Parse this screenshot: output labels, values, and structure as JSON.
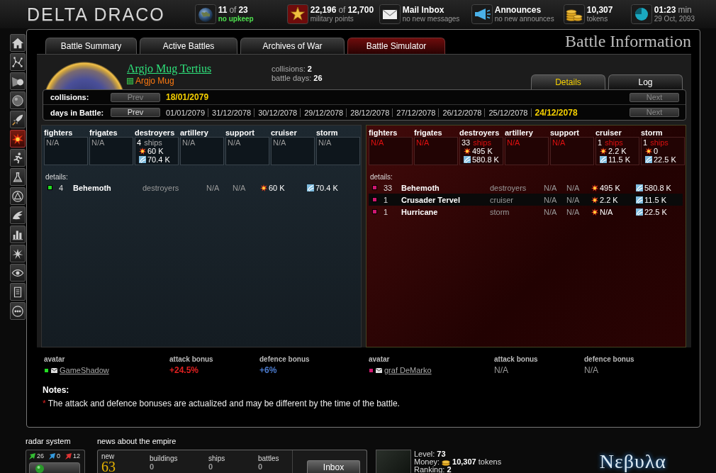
{
  "header": {
    "logo": "DELTA DRACO",
    "stats": [
      {
        "kind": "planets",
        "main": "11",
        "connector": "of",
        "total": "23",
        "caption": "no upkeep",
        "caption_highlighted": true
      },
      {
        "kind": "military",
        "main": "22,196",
        "connector": "of",
        "total": "12,700",
        "caption": "military points",
        "caption_highlighted": false
      },
      {
        "kind": "mail",
        "main": "Mail Inbox",
        "caption": "no new messages",
        "caption_highlighted": false
      },
      {
        "kind": "announces",
        "main": "Announces",
        "caption": "no new announces",
        "caption_highlighted": false
      },
      {
        "kind": "tokens",
        "main": "10,307",
        "caption": "tokens",
        "caption_highlighted": false
      },
      {
        "kind": "time",
        "main": "01:23",
        "unit": "min",
        "caption": "29 Oct, 2093",
        "caption_highlighted": false
      }
    ]
  },
  "sidebar": {
    "items": [
      {
        "selected": false
      },
      {
        "selected": false
      },
      {
        "selected": false
      },
      {
        "selected": false
      },
      {
        "selected": false
      },
      {
        "selected": true
      },
      {
        "selected": false
      },
      {
        "selected": false
      },
      {
        "selected": false
      },
      {
        "selected": false
      },
      {
        "selected": false
      },
      {
        "selected": false
      },
      {
        "selected": false
      },
      {
        "selected": false
      },
      {
        "selected": false
      }
    ]
  },
  "tabs": [
    {
      "label": "Battle Summary",
      "kind": "standard",
      "selected": false
    },
    {
      "label": "Active Battles",
      "kind": "standard",
      "selected": false
    },
    {
      "label": "Archives of War",
      "kind": "standard",
      "selected": false
    },
    {
      "label": "Battle Simulator",
      "kind": "simulator",
      "selected": false
    }
  ],
  "page_title": "Battle Information",
  "planet": {
    "name": "Argjo Mug Tertius",
    "owner": "Argjo Mug"
  },
  "battle_stats": [
    {
      "label": "collisions:",
      "value": "2"
    },
    {
      "label": "battle days:",
      "value": "26"
    }
  ],
  "view_tabs": [
    {
      "label": "Details",
      "selected": true
    },
    {
      "label": "Log",
      "selected": false
    }
  ],
  "navigation": [
    {
      "label": "collisions:",
      "prev": "Prev",
      "prev_disabled": true,
      "next": "Next",
      "next_disabled": true,
      "dates": [
        {
          "text": "18/01/2079",
          "selected": true
        }
      ]
    },
    {
      "label": "days in Battle:",
      "prev": "Prev",
      "prev_disabled": false,
      "next": "Next",
      "next_disabled": true,
      "dates": [
        {
          "text": "01/01/2079",
          "selected": false
        },
        {
          "text": "31/12/2078",
          "selected": false
        },
        {
          "text": "30/12/2078",
          "selected": false
        },
        {
          "text": "29/12/2078",
          "selected": false
        },
        {
          "text": "28/12/2078",
          "selected": false
        },
        {
          "text": "27/12/2078",
          "selected": false
        },
        {
          "text": "26/12/2078",
          "selected": false
        },
        {
          "text": "25/12/2078",
          "selected": false
        },
        {
          "text": "24/12/2078",
          "selected": true
        }
      ]
    }
  ],
  "sides": [
    {
      "kind": "ally",
      "color": "#22dd22",
      "units": [
        {
          "label": "fighters",
          "kind": "empty",
          "text": "N/A"
        },
        {
          "label": "frigates",
          "kind": "empty",
          "text": "N/A"
        },
        {
          "label": "destroyers",
          "kind": "fleet",
          "count": "4",
          "unit": "ships",
          "attack": "60 K",
          "defense": "70.4 K"
        },
        {
          "label": "artillery",
          "kind": "empty",
          "text": "N/A"
        },
        {
          "label": "support",
          "kind": "empty",
          "text": "N/A"
        },
        {
          "label": "cruiser",
          "kind": "empty",
          "text": "N/A"
        },
        {
          "label": "storm",
          "kind": "empty",
          "text": "N/A"
        }
      ],
      "details_label": "details:",
      "rows": [
        {
          "count": "4",
          "name": "Behemoth",
          "class": "destroyers",
          "column_5": "N/A",
          "column_6": "N/A",
          "attack": "60 K",
          "defense": "70.4 K",
          "highlighted": false
        }
      ],
      "avatar_label": "avatar",
      "avatar": "GameShadow",
      "bonuses": [
        {
          "kind": "attack",
          "label": "attack bonus",
          "value": "+24.5%",
          "active": true
        },
        {
          "kind": "defence",
          "label": "defence bonus",
          "value": "+6%",
          "active": true
        }
      ]
    },
    {
      "kind": "enemy",
      "color": "#d01870",
      "units": [
        {
          "label": "fighters",
          "kind": "empty",
          "text": "N/A"
        },
        {
          "label": "frigates",
          "kind": "empty",
          "text": "N/A"
        },
        {
          "label": "destroyers",
          "kind": "fleet",
          "count": "33",
          "unit": "ships",
          "attack": "495 K",
          "defense": "580.8 K"
        },
        {
          "label": "artillery",
          "kind": "empty",
          "text": "N/A"
        },
        {
          "label": "support",
          "kind": "empty",
          "text": "N/A"
        },
        {
          "label": "cruiser",
          "kind": "fleet",
          "count": "1",
          "unit": "ships",
          "attack": "2.2 K",
          "defense": "11.5 K"
        },
        {
          "label": "storm",
          "kind": "fleet",
          "count": "1",
          "unit": "ships",
          "attack": "0",
          "defense": "22.5 K"
        }
      ],
      "details_label": "details:",
      "rows": [
        {
          "count": "33",
          "name": "Behemoth",
          "class": "destroyers",
          "column_5": "N/A",
          "column_6": "N/A",
          "attack": "495 K",
          "defense": "580.8 K",
          "highlighted": false
        },
        {
          "count": "1",
          "name": "Crusader Tervel",
          "class": "cruiser",
          "column_5": "N/A",
          "column_6": "N/A",
          "attack": "2.2 K",
          "defense": "11.5 K",
          "highlighted": true
        },
        {
          "count": "1",
          "name": "Hurricane",
          "class": "storm",
          "column_5": "N/A",
          "column_6": "N/A",
          "attack": "N/A",
          "defense": "22.5 K",
          "highlighted": false
        }
      ],
      "avatar_label": "avatar",
      "avatar": "graf DeMarko",
      "bonuses": [
        {
          "kind": "attack",
          "label": "attack bonus",
          "value": "N/A",
          "active": false
        },
        {
          "kind": "defence",
          "label": "defence bonus",
          "value": "N/A",
          "active": false
        }
      ]
    }
  ],
  "notes": {
    "title": "Notes:",
    "items": [
      {
        "bullet": "*",
        "text": "The attack and defence bonuses are actualized and may be different by the time of the battle."
      }
    ]
  },
  "footer": {
    "radar": {
      "title": "radar system",
      "counts": [
        {
          "value": "26",
          "color": "#33bb33"
        },
        {
          "value": "0",
          "color": "#3399dd"
        },
        {
          "value": "12",
          "color": "#dd3333"
        }
      ]
    },
    "news": {
      "title": "news about the empire",
      "counters": [
        {
          "kind": "total",
          "label": "new",
          "value": "63"
        },
        {
          "kind": "count",
          "label": "buildings",
          "value": "0"
        },
        {
          "kind": "count",
          "label": "ships",
          "value": "0"
        },
        {
          "kind": "count",
          "label": "battles",
          "value": "0"
        }
      ],
      "button": "Inbox"
    },
    "profile": {
      "lines": [
        {
          "kind": "plain",
          "label": "Level:",
          "value": "73"
        },
        {
          "kind": "money",
          "label": "Money:",
          "value": "10,307",
          "unit": "tokens"
        },
        {
          "kind": "plain",
          "label": "Ranking:",
          "value": "2"
        }
      ]
    },
    "brand": "Nεβυλα"
  }
}
